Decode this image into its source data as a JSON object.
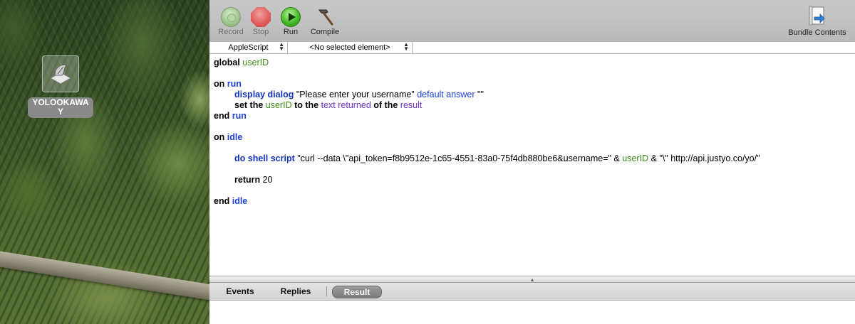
{
  "desktop": {
    "icon_label": "YOLOOKAWAY"
  },
  "toolbar": {
    "record_label": "Record",
    "stop_label": "Stop",
    "run_label": "Run",
    "compile_label": "Compile",
    "bundle_label": "Bundle Contents"
  },
  "navbar": {
    "language": "AppleScript",
    "element": "<No selected element>"
  },
  "script": {
    "l1_kw": "global",
    "l1_var": "userID",
    "l3_on": "on",
    "l3_run": "run",
    "l4_cmd": "display dialog",
    "l4_str": "\"Please enter your username\"",
    "l4_param": "default answer",
    "l4_str2": "\"\"",
    "l5_set": "set the",
    "l5_var": "userID",
    "l5_to": "to the",
    "l5_prop1": "text returned",
    "l5_of": "of the",
    "l5_prop2": "result",
    "l6_end": "end",
    "l6_run": "run",
    "l8_on": "on",
    "l8_idle": "idle",
    "l10_cmd": "do shell script",
    "l10_str": "\"curl --data \\\"api_token=f8b9512e-1c65-4551-83a0-75f4db880be6&username=\" &",
    "l10_var": "userID",
    "l10_tail": "& \"\\\" http://api.justyo.co/yo/\"",
    "l12_kw": "return",
    "l12_val": "20",
    "l14_end": "end",
    "l14_idle": "idle"
  },
  "tabs": {
    "events": "Events",
    "replies": "Replies",
    "result": "Result"
  },
  "icons": [
    "record-icon",
    "stop-icon",
    "run-icon",
    "compile-hammer-icon",
    "bundle-contents-icon",
    "applescript-app-icon"
  ]
}
